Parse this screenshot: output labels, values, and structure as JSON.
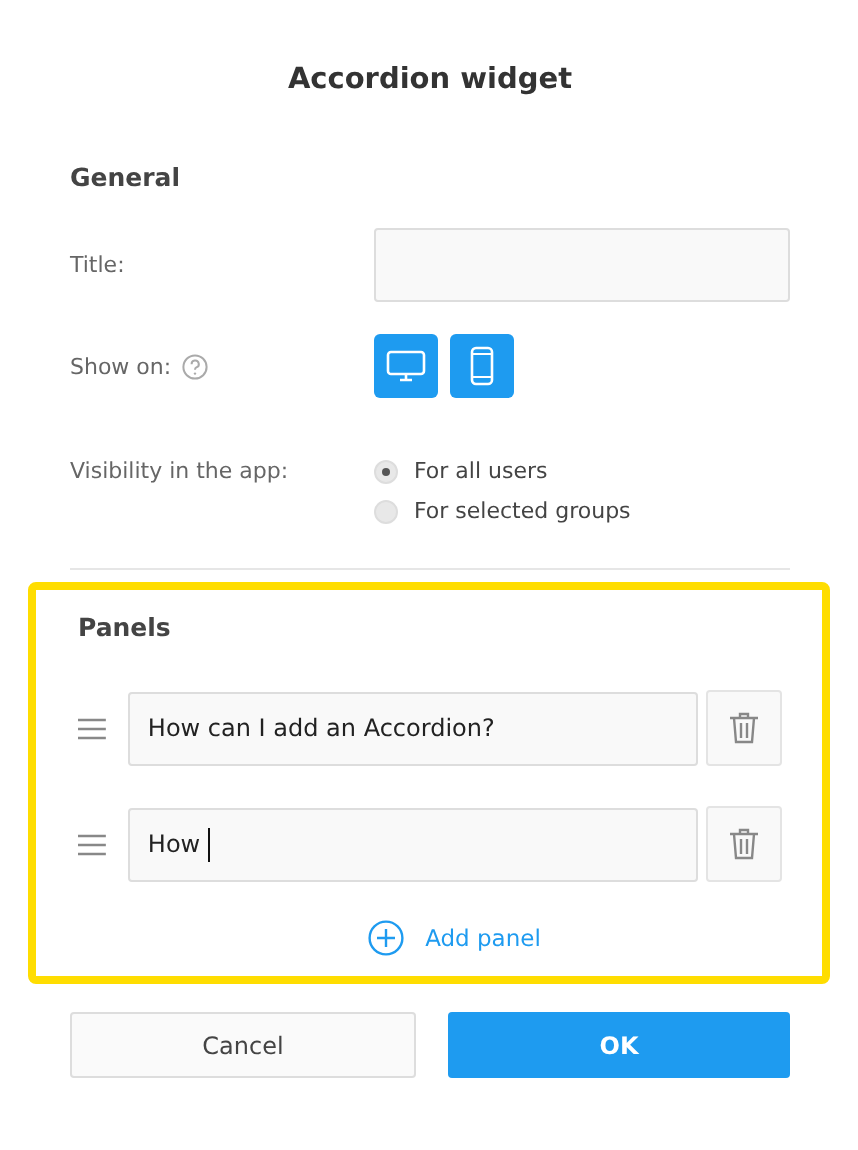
{
  "dialog": {
    "title": "Accordion widget"
  },
  "general": {
    "heading": "General",
    "title_field": {
      "label": "Title:"
    },
    "show_on": {
      "label": "Show on:",
      "devices": [
        {
          "kind": "desktop",
          "selected": true
        },
        {
          "kind": "mobile",
          "selected": true
        }
      ]
    },
    "visibility": {
      "label": "Visibility in the app:",
      "options": [
        {
          "label": "For all users",
          "selected": true
        },
        {
          "label": "For selected groups",
          "selected": false
        }
      ]
    }
  },
  "panels": {
    "heading": "Panels",
    "highlighted": true,
    "items": [
      {
        "value": "How can I add an Accordion?",
        "focused": false
      },
      {
        "value": "How",
        "focused": true
      }
    ],
    "add_label": "Add panel"
  },
  "buttons": {
    "cancel": "Cancel",
    "ok": "OK"
  }
}
